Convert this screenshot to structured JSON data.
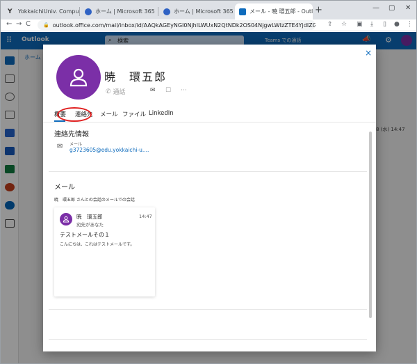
{
  "browser": {
    "tabs": [
      {
        "title": "YokkaichiUniv. Computer",
        "favicon_color": "#333333"
      },
      {
        "title": "ホーム | Microsoft 365",
        "favicon_color": "#2f62c4"
      },
      {
        "title": "ホーム | Microsoft 365",
        "favicon_color": "#2f62c4"
      },
      {
        "title": "メール - 暁 環五郎 - Outl",
        "favicon_color": "#0f6cbd"
      }
    ],
    "new_tab_label": "+",
    "url": "outlook.office.com/mail/inbox/id/AAQkAGEyNGI0NjhlLWUxN2QtNDk2OS04NjgwLWIzZTE4YjdlZGJhY...",
    "back": "←",
    "forward": "→",
    "reload": "C"
  },
  "outlook": {
    "app_name": "Outlook",
    "search_placeholder": "検索",
    "teams_label": "Teams での通話",
    "home_tab": "ホーム",
    "right_date": "8 (水) 14:47"
  },
  "dialog": {
    "close": "×",
    "contact_name": "暁　環五郎",
    "actions": {
      "call": "通話",
      "mail_icon": "mail-icon",
      "chat_icon": "chat-icon",
      "more": "···"
    },
    "tabs": [
      "概要",
      "連絡先",
      "メール",
      "ファイル",
      "LinkedIn"
    ],
    "contact_section_title": "連絡先情報",
    "email_label": "メール",
    "email_value": "g3723605@edu.yokkaichi-u....",
    "mail_section_title": "メール",
    "mail_filter": "暁　環五郎 さんとの会話のメールでの会話",
    "card": {
      "sender": "暁　環五郎",
      "recipient": "宛先があなた",
      "time": "14:47",
      "subject": "テストメールその１",
      "preview": "こんにちは、これはテストメールです。"
    },
    "accent": "#7b2fa7",
    "highlight": "#e02020"
  }
}
